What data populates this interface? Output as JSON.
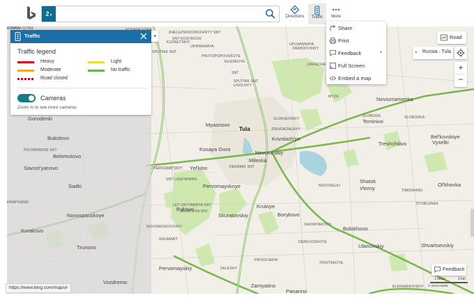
{
  "topbar": {
    "search_badge": "2",
    "search_value": "",
    "directions_label": "Directions",
    "traffic_label": "Traffic",
    "more_label": "More"
  },
  "traffic_panel": {
    "title": "Traffic",
    "legend_title": "Traffic legend",
    "legend": [
      {
        "label": "Heavy",
        "color": "#d0021b"
      },
      {
        "label": "Moderate",
        "color": "#f5a623"
      },
      {
        "label": "Road closed",
        "color": "#d0021b"
      },
      {
        "label": "Light",
        "color": "#e8e03b"
      },
      {
        "label": "No traffic",
        "color": "#6ab04c"
      }
    ],
    "cameras_label": "Cameras",
    "cameras_on": true,
    "cameras_note": "Zoom in to see more cameras"
  },
  "more_menu": {
    "items": [
      {
        "label": "Share",
        "icon": "share-icon"
      },
      {
        "label": "Print",
        "icon": "print-icon"
      },
      {
        "label": "Feedback",
        "icon": "feedback-icon",
        "has_submenu": true
      },
      {
        "label": "Full Screen",
        "icon": "fullscreen-icon"
      },
      {
        "label": "Embed a map",
        "icon": "embed-icon"
      }
    ]
  },
  "map_controls": {
    "road_label": "Road",
    "breadcrumb": "Russia · Tula",
    "zoom_in": "+",
    "zoom_out": "−",
    "feedback_label": "Feedback",
    "scale_miles": "1 miles",
    "scale_km": "2 km",
    "copyright": "© 2016 HERE"
  },
  "status_url": "https://www.bing.com/maps#",
  "map_labels": [
    {
      "text": "KOSAYA GORA",
      "cls": "small"
    },
    {
      "text": "Gorodenki",
      "cls": "big"
    },
    {
      "text": "Bukolovo",
      "cls": "big"
    },
    {
      "text": "POLYANSKOE SKT",
      "cls": "small"
    },
    {
      "text": "Belomutovo",
      "cls": "big"
    },
    {
      "text": "Savost'yanovo",
      "cls": "big"
    },
    {
      "text": "Sadki",
      "cls": "big"
    },
    {
      "text": "KRAPIVENO",
      "cls": "small"
    },
    {
      "text": "Novospasskoye",
      "cls": "big"
    },
    {
      "text": "Kurakovo",
      "cls": "big"
    },
    {
      "text": "Trunovo",
      "cls": "big"
    },
    {
      "text": "Vozdremo",
      "cls": "big"
    },
    {
      "text": "SNT KOSTROVO",
      "cls": "small"
    },
    {
      "text": "KUZNETSKIY",
      "cls": "small"
    },
    {
      "text": "ZHELEZNODOROZHNYY SNT",
      "cls": "small"
    },
    {
      "text": "SPUTNIK SNT",
      "cls": "small"
    },
    {
      "text": "UKIRNANAYA",
      "cls": "small"
    },
    {
      "text": "PROTOPOPOVSKOYE",
      "cls": "small"
    },
    {
      "text": "RUSSKOYE",
      "cls": "small"
    },
    {
      "text": "SNT",
      "cls": "small"
    },
    {
      "text": "SPUTNIK SNT",
      "cls": "small"
    },
    {
      "text": "UGOLNYY",
      "cls": "small"
    },
    {
      "text": "(ZARECHENSKIY)",
      "cls": "small"
    },
    {
      "text": "MYZA",
      "cls": "small"
    },
    {
      "text": "DEMIDOVSKIY",
      "cls": "small"
    },
    {
      "text": "UPLNANNAYA",
      "cls": "small"
    },
    {
      "text": "Novoznamenka",
      "cls": "big"
    },
    {
      "text": "SLOBODA",
      "cls": "small"
    },
    {
      "text": "Teminivo",
      "cls": "big"
    },
    {
      "text": "SLOBODKA",
      "cls": "small"
    },
    {
      "text": "Bel'kovskiye",
      "cls": "big"
    },
    {
      "text": "Vyselki",
      "cls": "big"
    },
    {
      "text": "Treshchilivo",
      "cls": "big"
    },
    {
      "text": "Myasnovo",
      "cls": "big"
    },
    {
      "text": "Tula",
      "cls": "bold"
    },
    {
      "text": "SLUKHEVSKIY",
      "cls": "small"
    },
    {
      "text": "Krivolach'ye",
      "cls": "big"
    },
    {
      "text": "PRIVOKZALNYY",
      "cls": "small"
    },
    {
      "text": "Kosaya Gora",
      "cls": "big"
    },
    {
      "text": "Novotul'skiy",
      "cls": "big"
    },
    {
      "text": "Mileska",
      "cls": "big"
    },
    {
      "text": "Yel'kino",
      "cls": "big"
    },
    {
      "text": "KERAMIK SNT",
      "cls": "small"
    },
    {
      "text": "PERVOMAYSKIY",
      "cls": "small"
    },
    {
      "text": "Pervomayskoye",
      "cls": "big"
    },
    {
      "text": "SNT LIGHTENING",
      "cls": "small"
    },
    {
      "text": "NOVOSELKI",
      "cls": "small"
    },
    {
      "text": "Shatsk",
      "cls": "big"
    },
    {
      "text": "Vtoroy",
      "cls": "big"
    },
    {
      "text": "Ol'khovka",
      "cls": "big"
    },
    {
      "text": "TIMOKHINO",
      "cls": "small"
    },
    {
      "text": "STUBLENKA",
      "cls": "small"
    },
    {
      "text": "Krutoye",
      "cls": "big"
    },
    {
      "text": "Skuratovskiy",
      "cls": "big"
    },
    {
      "text": "Borykovo",
      "cls": "big"
    },
    {
      "text": "KHOMYAKOVO",
      "cls": "small"
    },
    {
      "text": "Bolokhovo",
      "cls": "big"
    },
    {
      "text": "LET OKTYABRYA SNT",
      "cls": "small"
    },
    {
      "text": "Ulanovskiy",
      "cls": "big"
    },
    {
      "text": "Shvartsevskiy",
      "cls": "big"
    },
    {
      "text": "GRUMANT",
      "cls": "small"
    },
    {
      "text": "DEREVOSKOYE",
      "cls": "small"
    },
    {
      "text": "Pervomayskiy",
      "cls": "big"
    },
    {
      "text": "ZALESHY",
      "cls": "small"
    },
    {
      "text": "TROITSKOYE",
      "cls": "small"
    },
    {
      "text": "Zamyatino",
      "cls": "big"
    },
    {
      "text": "Panarino",
      "cls": "big"
    },
    {
      "text": "ELEKHANOVSKIY",
      "cls": "small"
    },
    {
      "text": "Bykovo",
      "cls": "big"
    },
    {
      "text": "AVIATSIYA SNT",
      "cls": "small"
    },
    {
      "text": "NOVOMOSKOVSKIY",
      "cls": "small"
    },
    {
      "text": "PRIVOLNAYA",
      "cls": "small"
    },
    {
      "text": "IL'INKA",
      "cls": "small"
    },
    {
      "text": "KOSAYA GORA",
      "cls": "small"
    }
  ]
}
